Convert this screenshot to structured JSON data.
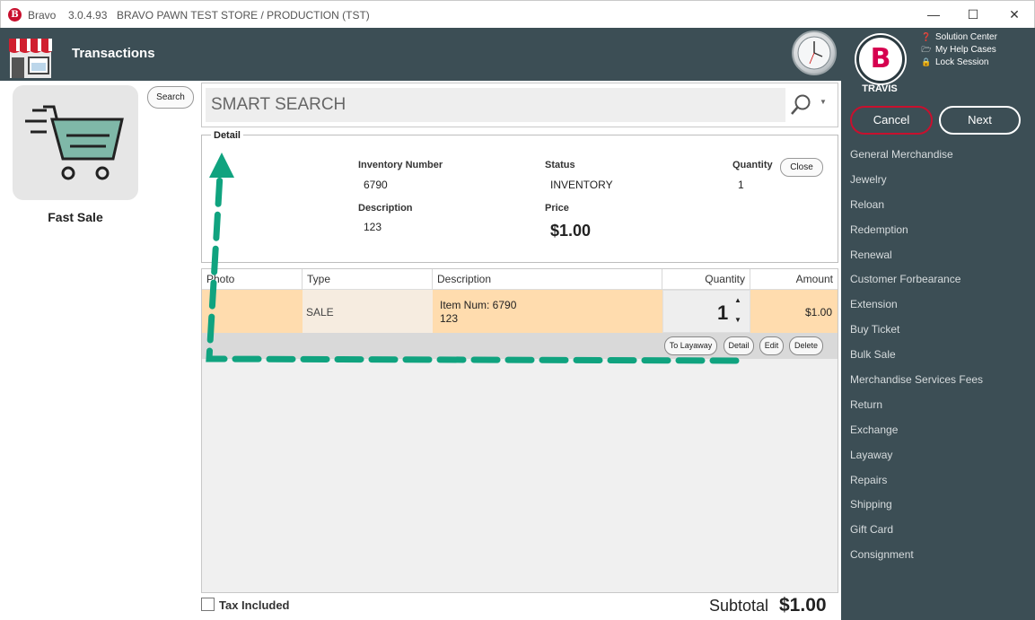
{
  "window": {
    "app_name": "Bravo",
    "version": "3.0.4.93",
    "store": "BRAVO PAWN TEST STORE / PRODUCTION (TST)",
    "app_icon_letter": "B"
  },
  "header": {
    "title": "Transactions"
  },
  "user": {
    "name": "TRAVIS",
    "avatar_letter": "B",
    "links": [
      "Solution Center",
      "My Help Cases",
      "Lock Session"
    ]
  },
  "actions": {
    "cancel": "Cancel",
    "next": "Next"
  },
  "menu": [
    "General Merchandise",
    "Jewelry",
    "Reloan",
    "Redemption",
    "Renewal",
    "Customer Forbearance",
    "Extension",
    "Buy Ticket",
    "Bulk Sale",
    "Merchandise Services Fees",
    "Return",
    "Exchange",
    "Layaway",
    "Repairs",
    "Shipping",
    "Gift Card",
    "Consignment"
  ],
  "left": {
    "tile_label": "Fast Sale",
    "search_button": "Search"
  },
  "smart_search": {
    "placeholder": "SMART SEARCH"
  },
  "detail": {
    "legend": "Detail",
    "inventory_number_label": "Inventory Number",
    "inventory_number": "6790",
    "status_label": "Status",
    "status": "INVENTORY",
    "quantity_label": "Quantity",
    "quantity": "1",
    "description_label": "Description",
    "description": "123",
    "price_label": "Price",
    "price": "$1.00",
    "close_button": "Close"
  },
  "table": {
    "columns": [
      "Photo",
      "Type",
      "Description",
      "Quantity",
      "Amount"
    ],
    "rows": [
      {
        "type": "SALE",
        "desc_line1": "Item Num: 6790",
        "desc_line2": "123",
        "quantity": "1",
        "amount": "$1.00"
      }
    ],
    "row_actions": [
      "To Layaway",
      "Detail",
      "Edit",
      "Delete"
    ]
  },
  "footer": {
    "tax_included": "Tax Included",
    "subtotal_label": "Subtotal",
    "subtotal": "$1.00"
  },
  "colors": {
    "panel": "#3c4e55",
    "row_highlight": "#ffdcae",
    "cancel_border": "#c8102e",
    "annotation": "#10a37f"
  }
}
